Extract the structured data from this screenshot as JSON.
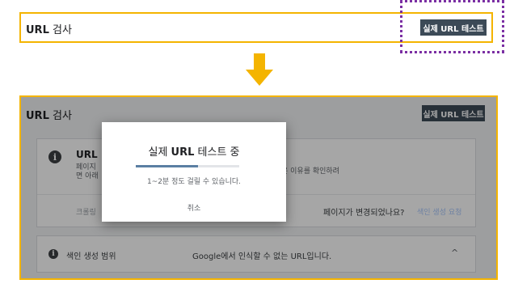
{
  "top": {
    "title_url": "URL",
    "title_rest": " 검사",
    "test_button": "실제 URL 테스트"
  },
  "panel": {
    "title_url": "URL",
    "title_rest": " 검사",
    "test_button": "실제 URL 테스트",
    "card": {
      "title": "URL",
      "desc_line1": "페이지",
      "desc_line2": "면 아래",
      "desc_right": "은 이유를 확인하려",
      "crawl_text": "크롤링",
      "changed_text": "페이지가 변경되었나요?",
      "request_link": "색인 생성 요청"
    },
    "coverage": {
      "label": "색인 생성 범위",
      "value": "Google에서 인식할 수 없는 URL입니다.",
      "chevron": "^"
    },
    "dialog": {
      "title_pre": "실제 ",
      "title_url": "URL",
      "title_post": " 테스트 중",
      "progress": 0.6,
      "subtext": "1~2분 정도 걸릴 수 있습니다.",
      "cancel": "취소"
    }
  },
  "colors": {
    "highlight_border": "#f4b400",
    "dotted_border": "#7b2fa3",
    "button_bg": "#3c4a57",
    "arrow": "#f4b400",
    "progress": "#5b7fa3"
  }
}
